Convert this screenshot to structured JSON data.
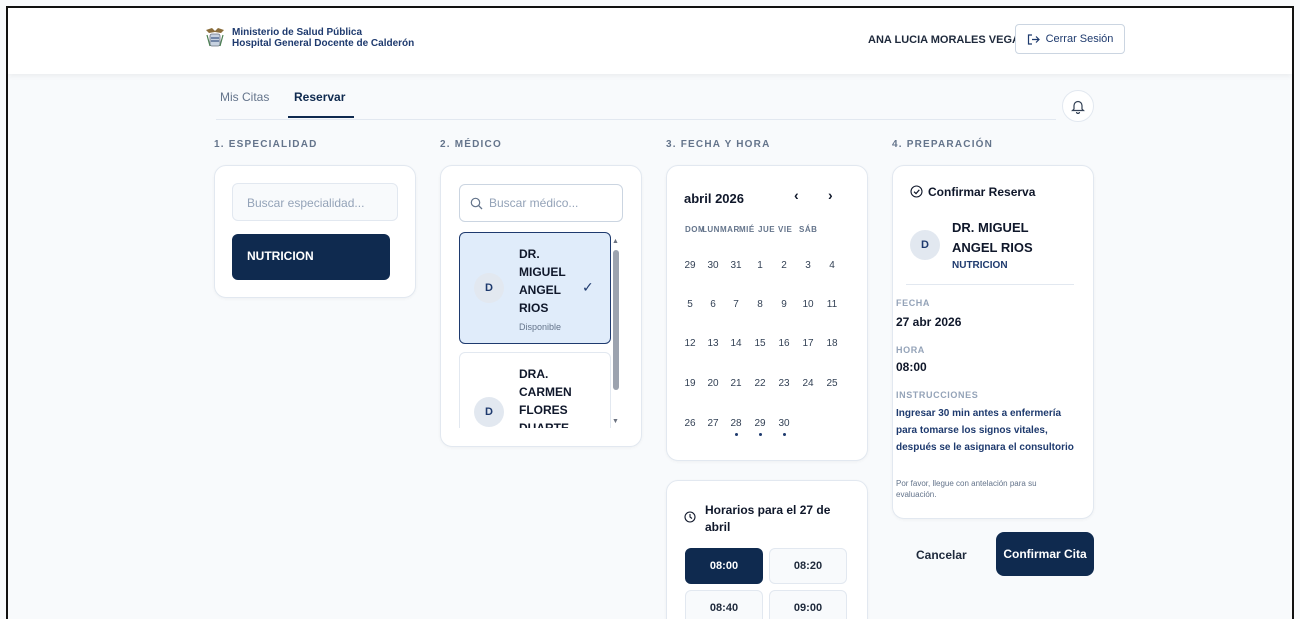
{
  "header": {
    "org_line1": "Ministerio de Salud Pública",
    "org_line2": "Hospital General Docente de Calderón",
    "user_name": "ANA LUCIA MORALES VEGA",
    "logout_label": "Cerrar Sesión",
    "logout_icon": "logout-icon"
  },
  "tabs": [
    {
      "label": "Mis Citas",
      "active": false
    },
    {
      "label": "Reservar",
      "active": true
    }
  ],
  "steps": {
    "especialidad": "1. ESPECIALIDAD",
    "medico": "2. MÉDICO",
    "fecha_hora": "3. FECHA Y HORA",
    "preparacion": "4. PREPARACIÓN"
  },
  "especialidad": {
    "search_placeholder": "Buscar especialidad...",
    "items": [
      "NUTRICION"
    ]
  },
  "medico": {
    "search_placeholder": "Buscar médico...",
    "doctors": [
      {
        "initial": "D",
        "name_lines": [
          "DR.",
          "MIGUEL",
          "ANGEL",
          "RIOS"
        ],
        "status": "Disponible",
        "selected": true
      },
      {
        "initial": "D",
        "name_lines": [
          "DRA.",
          "CARMEN",
          "FLORES",
          "DUARTE"
        ],
        "status": "",
        "selected": false
      }
    ]
  },
  "calendar": {
    "month_label": "abril 2026",
    "prev_icon": "‹",
    "next_icon": "›",
    "weekdays": [
      "DOM",
      "LUN",
      "MAR",
      "MIÉ",
      "JUE",
      "VIE",
      "SÁB"
    ],
    "weeks": [
      [
        "29",
        "30",
        "31",
        "1",
        "2",
        "3",
        "4"
      ],
      [
        "5",
        "6",
        "7",
        "8",
        "9",
        "10",
        "11"
      ],
      [
        "12",
        "13",
        "14",
        "15",
        "16",
        "17",
        "18"
      ],
      [
        "19",
        "20",
        "21",
        "22",
        "23",
        "24",
        "25"
      ],
      [
        "26",
        "27",
        "28",
        "29",
        "30",
        "",
        ""
      ]
    ],
    "marked_days": [
      "28",
      "29",
      "30"
    ]
  },
  "horarios": {
    "title": "Horarios para el 27 de abril",
    "slots": [
      {
        "time": "08:00",
        "selected": true
      },
      {
        "time": "08:20",
        "selected": false
      },
      {
        "time": "08:40",
        "selected": false
      },
      {
        "time": "09:00",
        "selected": false
      }
    ]
  },
  "confirmacion": {
    "title": "Confirmar Reserva",
    "doctor_initial": "D",
    "doctor_name": "DR. MIGUEL ANGEL RIOS",
    "specialty": "NUTRICION",
    "fecha_label": "FECHA",
    "fecha_value": "27 abr 2026",
    "hora_label": "HORA",
    "hora_value": "08:00",
    "instrucciones_label": "INSTRUCCIONES",
    "instrucciones_text": "Ingresar 30 min antes a enfermería para tomarse los signos vitales, después se le asignara el consultorio",
    "note": "Por favor, llegue con antelación para su evaluación.",
    "cancel_label": "Cancelar",
    "confirm_label": "Confirmar Cita"
  },
  "colors": {
    "primary": "#0f2a4f",
    "selected_bg": "#e0ecfa",
    "muted": "#64748b"
  }
}
